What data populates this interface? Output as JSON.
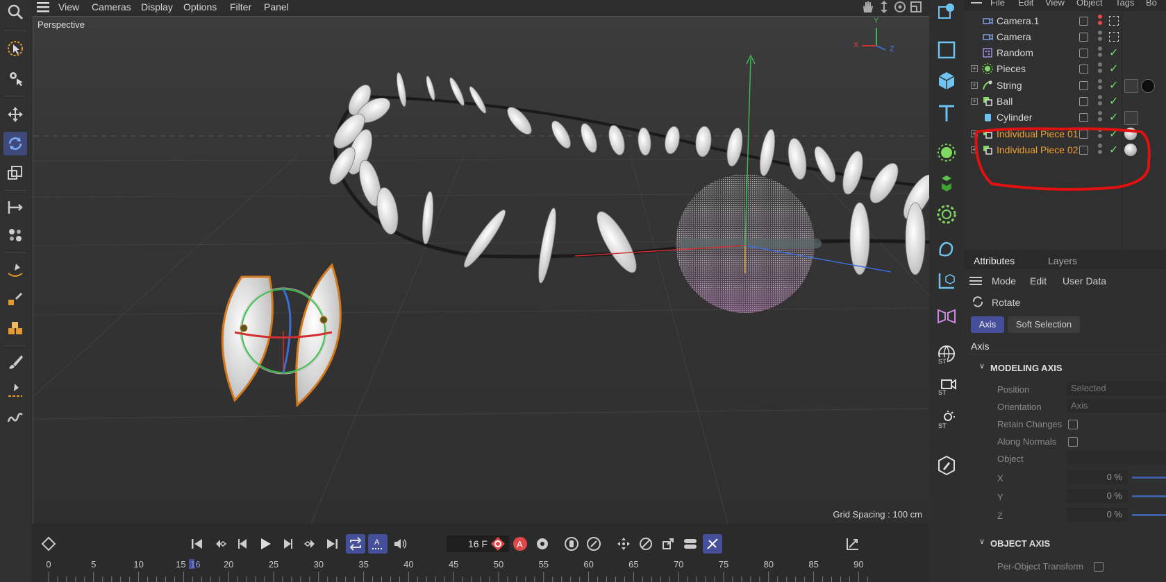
{
  "menubar": {
    "items": [
      "View",
      "Cameras",
      "Display",
      "Options",
      "Filter",
      "Panel"
    ]
  },
  "viewport": {
    "label": "Perspective",
    "grid_spacing": "Grid Spacing : 100 cm",
    "axis_labels": {
      "x": "X",
      "y": "Y",
      "z": "Z"
    }
  },
  "object_manager": {
    "menu": [
      "File",
      "Edit",
      "View",
      "Object",
      "Tags",
      "Bo"
    ],
    "objects": [
      {
        "name": "Camera.1",
        "icon": "camera-icon",
        "expandable": false,
        "selected": false
      },
      {
        "name": "Camera",
        "icon": "camera-icon",
        "expandable": false,
        "selected": false
      },
      {
        "name": "Random",
        "icon": "random-effector-icon",
        "expandable": false,
        "selected": false
      },
      {
        "name": "Pieces",
        "icon": "cloner-icon",
        "expandable": true,
        "selected": false
      },
      {
        "name": "String",
        "icon": "spline-icon",
        "expandable": true,
        "selected": false
      },
      {
        "name": "Ball",
        "icon": "null-icon",
        "expandable": true,
        "selected": false
      },
      {
        "name": "Cylinder",
        "icon": "cylinder-icon",
        "expandable": false,
        "selected": false
      },
      {
        "name": "Individual Piece 01",
        "icon": "null-icon",
        "expandable": true,
        "selected": true
      },
      {
        "name": "Individual Piece 02",
        "icon": "null-icon",
        "expandable": true,
        "selected": true
      }
    ]
  },
  "attributes": {
    "tabs": [
      "Attributes",
      "Layers"
    ],
    "menu": [
      "Mode",
      "Edit",
      "User Data"
    ],
    "tool_name": "Rotate",
    "subtabs": [
      "Axis",
      "Soft Selection"
    ],
    "section_heading": "Axis",
    "modeling_axis": {
      "title": "MODELING AXIS",
      "position_label": "Position",
      "position_value": "Selected",
      "orientation_label": "Orientation",
      "orientation_value": "Axis",
      "retain_label": "Retain Changes",
      "normals_label": "Along Normals",
      "object_label": "Object",
      "x_label": "X",
      "x_value": "0 %",
      "y_label": "Y",
      "y_value": "0 %",
      "z_label": "Z",
      "z_value": "0 %"
    },
    "object_axis": {
      "title": "OBJECT AXIS",
      "per_object_label": "Per-Object Transform"
    }
  },
  "timeline": {
    "current_frame": "16 F",
    "ruler_labels": [
      "0",
      "5",
      "10",
      "15",
      "16",
      "20",
      "25",
      "30",
      "35",
      "40",
      "45",
      "50",
      "55",
      "60",
      "65",
      "70",
      "75",
      "80",
      "85",
      "90"
    ]
  },
  "colors": {
    "accent": "#3f4a7a",
    "selected_object": "#f0a030",
    "annotation": "#e11111",
    "check": "#6adf6a"
  }
}
